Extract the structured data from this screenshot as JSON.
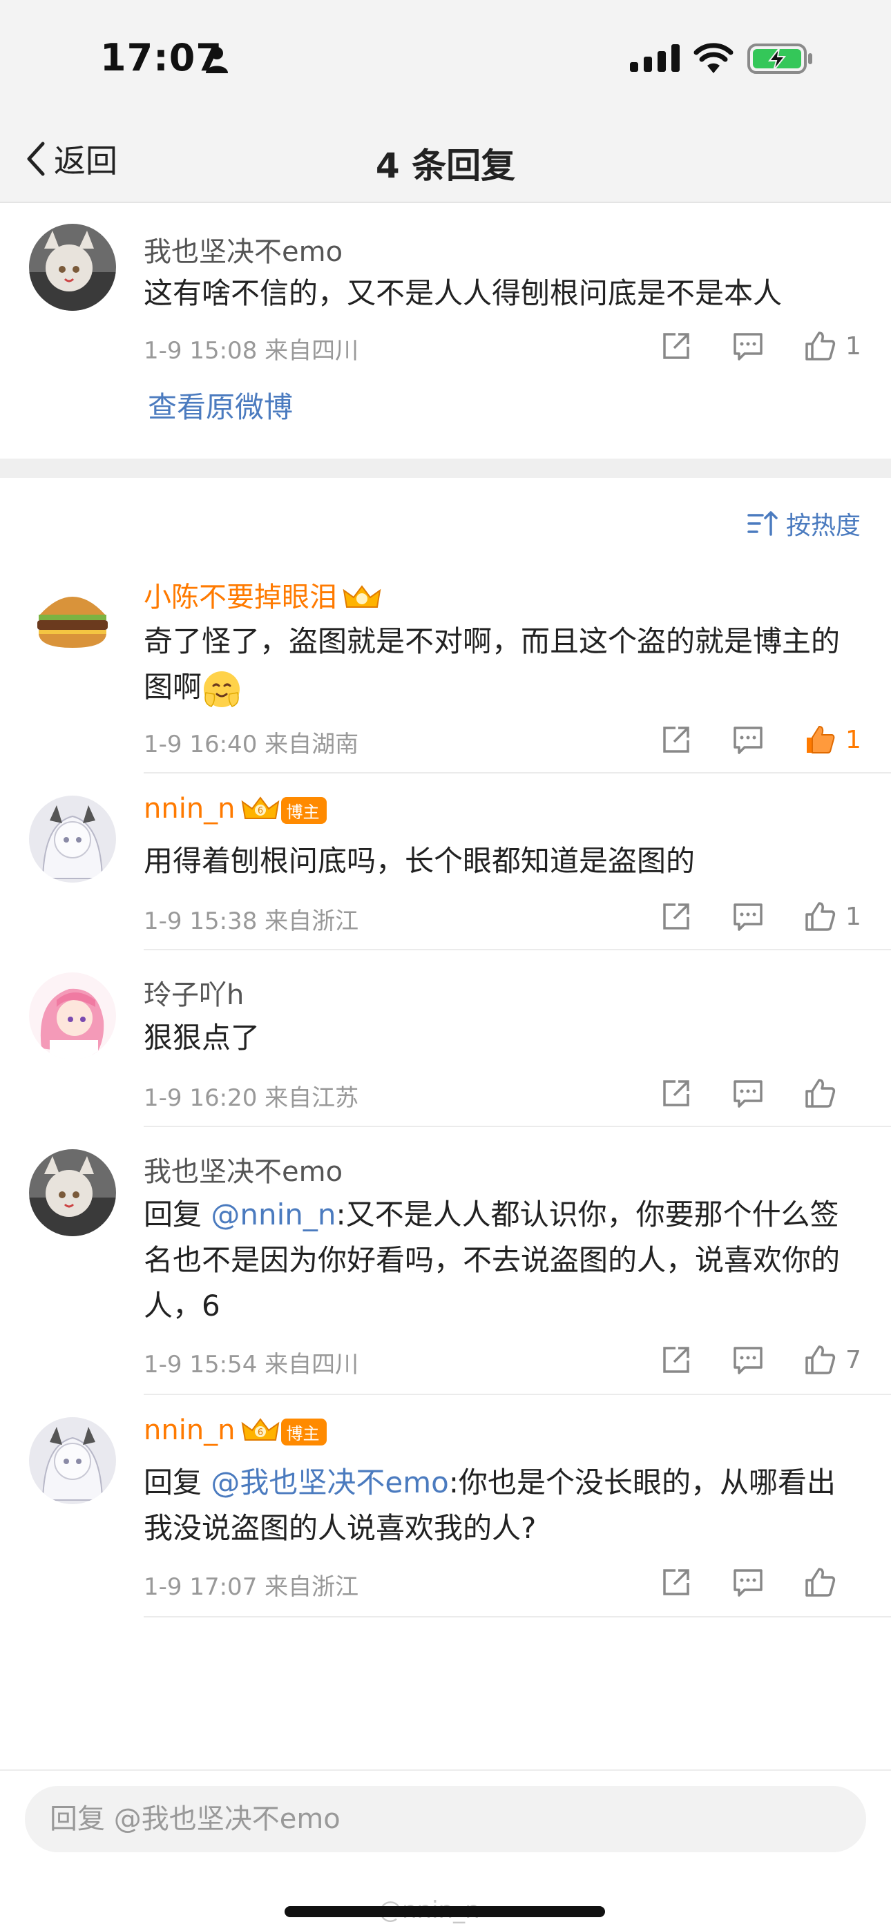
{
  "status_bar": {
    "time": "17:07"
  },
  "nav": {
    "back_label": "返回",
    "title": "4 条回复"
  },
  "root_comment": {
    "username": "我也坚决不emo",
    "content": "这有啥不信的，又不是人人得刨根问底是不是本人",
    "meta": "1-9 15:08  来自四川",
    "likes": "1",
    "view_original": "查看原微博"
  },
  "sort": {
    "label": "按热度"
  },
  "badges": {
    "bozhu": "博主",
    "crown_level": "6"
  },
  "replies": [
    {
      "username": "小陈不要掉眼泪",
      "content": "奇了怪了，盗图就是不对啊，而且这个盗的就是博主的图啊",
      "meta": "1-9 16:40  来自湖南",
      "likes": "1"
    },
    {
      "username": "nnin_n",
      "content": "用得着刨根问底吗，长个眼都知道是盗图的",
      "meta": "1-9 15:38  来自浙江",
      "likes": "1"
    },
    {
      "username": "玲子吖h",
      "content": "狠狠点了",
      "meta": "1-9 16:20  来自江苏",
      "likes": ""
    },
    {
      "username": "我也坚决不emo",
      "reply_prefix": "回复 ",
      "mention": "@nnin_n",
      "content": ":又不是人人都认识你，你要那个什么签名也不是因为你好看吗，不去说盗图的人，说喜欢你的人，6",
      "meta": "1-9 15:54  来自四川",
      "likes": "7"
    },
    {
      "username": "nnin_n",
      "reply_prefix": "回复 ",
      "mention": "@我也坚决不emo",
      "content": ":你也是个没长眼的，从哪看出我没说盗图的人说喜欢我的人?",
      "meta": "1-9 17:07  来自浙江",
      "likes": ""
    }
  ],
  "reply_bar": {
    "placeholder": "回复 @我也坚决不emo"
  },
  "watermark": "@nnin_n",
  "colors": {
    "accent": "#ff7a00",
    "link": "#4b7bbf"
  }
}
